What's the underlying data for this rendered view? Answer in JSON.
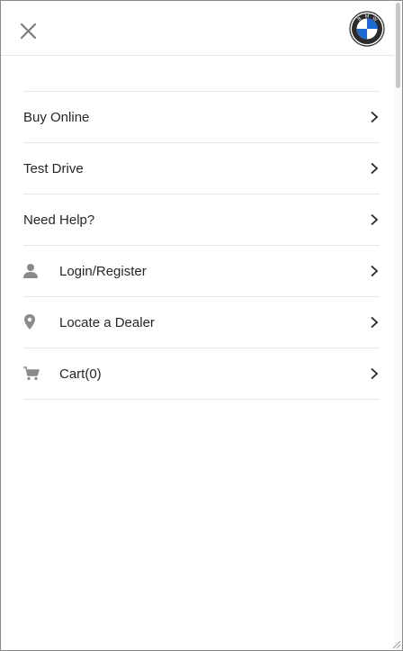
{
  "header": {
    "close_icon": "close-icon",
    "logo_icon": "bmw-logo",
    "logo_letters": "BMW",
    "logo_colors": {
      "blue": "#1c69d4",
      "ring": "#2b2b2b"
    }
  },
  "menu": {
    "items": [
      {
        "label": "Buy Online",
        "icon": null,
        "chevron": "chevron-right-icon"
      },
      {
        "label": "Test Drive",
        "icon": null,
        "chevron": "chevron-right-icon"
      },
      {
        "label": "Need Help?",
        "icon": null,
        "chevron": "chevron-right-icon"
      },
      {
        "label": "Login/Register",
        "icon": "person-icon",
        "chevron": "chevron-right-icon"
      },
      {
        "label": "Locate a Dealer",
        "icon": "location-pin-icon",
        "chevron": "chevron-right-icon"
      },
      {
        "label": "Cart(0)",
        "icon": "cart-icon",
        "chevron": "chevron-right-icon"
      }
    ]
  },
  "colors": {
    "text": "#262626",
    "icon": "#8a8a8a",
    "divider": "#e6e6e6"
  }
}
